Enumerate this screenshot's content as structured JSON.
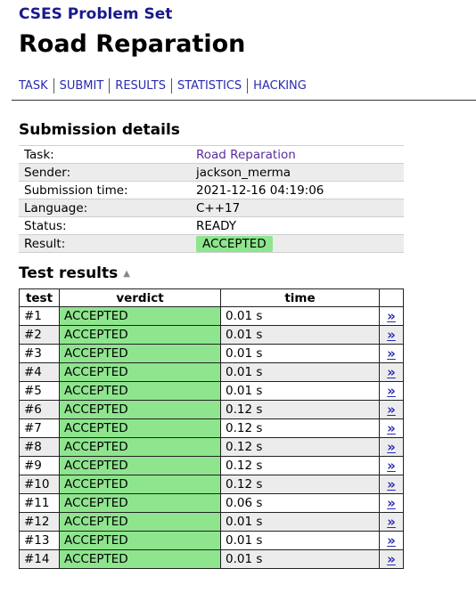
{
  "site": {
    "title": "CSES Problem Set"
  },
  "page": {
    "title": "Road Reparation"
  },
  "nav": {
    "items": [
      "TASK",
      "SUBMIT",
      "RESULTS",
      "STATISTICS",
      "HACKING"
    ]
  },
  "submission": {
    "heading": "Submission details",
    "rows": [
      {
        "label": "Task:",
        "value": "Road Reparation"
      },
      {
        "label": "Sender:",
        "value": "jackson_merma"
      },
      {
        "label": "Submission time:",
        "value": "2021-12-16 04:19:06"
      },
      {
        "label": "Language:",
        "value": "C++17"
      },
      {
        "label": "Status:",
        "value": "READY"
      },
      {
        "label": "Result:",
        "value": "ACCEPTED"
      }
    ]
  },
  "tests": {
    "heading": "Test results",
    "sort_icon": "▲",
    "headers": {
      "test": "test",
      "verdict": "verdict",
      "time": "time"
    },
    "link_glyph": "»",
    "rows": [
      {
        "test": "#1",
        "verdict": "ACCEPTED",
        "time": "0.01 s"
      },
      {
        "test": "#2",
        "verdict": "ACCEPTED",
        "time": "0.01 s"
      },
      {
        "test": "#3",
        "verdict": "ACCEPTED",
        "time": "0.01 s"
      },
      {
        "test": "#4",
        "verdict": "ACCEPTED",
        "time": "0.01 s"
      },
      {
        "test": "#5",
        "verdict": "ACCEPTED",
        "time": "0.01 s"
      },
      {
        "test": "#6",
        "verdict": "ACCEPTED",
        "time": "0.12 s"
      },
      {
        "test": "#7",
        "verdict": "ACCEPTED",
        "time": "0.12 s"
      },
      {
        "test": "#8",
        "verdict": "ACCEPTED",
        "time": "0.12 s"
      },
      {
        "test": "#9",
        "verdict": "ACCEPTED",
        "time": "0.12 s"
      },
      {
        "test": "#10",
        "verdict": "ACCEPTED",
        "time": "0.12 s"
      },
      {
        "test": "#11",
        "verdict": "ACCEPTED",
        "time": "0.06 s"
      },
      {
        "test": "#12",
        "verdict": "ACCEPTED",
        "time": "0.01 s"
      },
      {
        "test": "#13",
        "verdict": "ACCEPTED",
        "time": "0.01 s"
      },
      {
        "test": "#14",
        "verdict": "ACCEPTED",
        "time": "0.01 s"
      }
    ]
  },
  "colors": {
    "accepted": "#8ee58e",
    "link": "#2a2ab0",
    "title": "#1a1a8c"
  }
}
